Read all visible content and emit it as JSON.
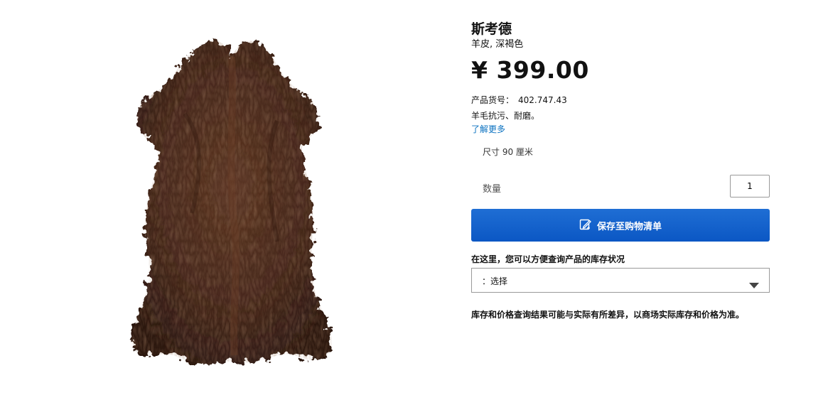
{
  "product": {
    "name": "斯考德",
    "subtitle": "羊皮, 深褐色",
    "price": "¥ 399.00",
    "article_label": "产品货号：",
    "article_number": "402.747.43",
    "description": "羊毛抗污、耐磨。",
    "learn_more": "了解更多",
    "size_text": "尺寸 90 厘米",
    "image_icon": "sheepskin-rug-image",
    "image_color": "#4a2a1c"
  },
  "quantity": {
    "label": "数量",
    "value": "1"
  },
  "save_button": {
    "label": "保存至购物清单",
    "icon": "edit-list-icon",
    "color": "#0b5fcf"
  },
  "stock": {
    "label": "在这里，您可以方便查询产品的库存状况",
    "select_value": "：选择",
    "disclaimer": "库存和价格查询结果可能与实际有所差异，以商场实际库存和价格为准。"
  },
  "colors": {
    "link": "#0a71c0",
    "text": "#111111"
  }
}
